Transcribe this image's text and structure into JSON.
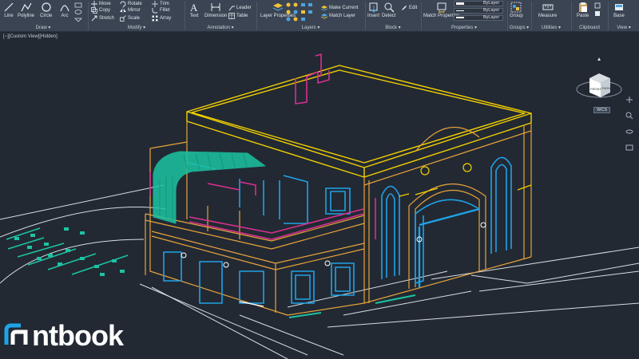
{
  "ribbon": {
    "draw": {
      "title": "Draw ▾",
      "tools": [
        "Line",
        "Polyline",
        "Circle",
        "Arc"
      ]
    },
    "modify": {
      "title": "Modify ▾",
      "tools": [
        "Move",
        "Copy",
        "Stretch",
        "Rotate",
        "Mirror",
        "Scale",
        "Trim",
        "Fillet",
        "Array"
      ]
    },
    "annotation": {
      "title": "Annotation ▾",
      "tools": [
        "Text",
        "Dimension",
        "Leader",
        "Table"
      ]
    },
    "layers": {
      "title": "Layers ▾",
      "tools": [
        "Layer Properties",
        "Make Current",
        "Match Layer"
      ]
    },
    "block": {
      "title": "Block ▾",
      "tools": [
        "Insert",
        "Detect",
        "Edit"
      ]
    },
    "properties": {
      "title": "Properties ▾",
      "tools": [
        "Match Properties"
      ],
      "dropdowns": [
        "ByLayer",
        "ByLayer",
        "ByLayer"
      ]
    },
    "groups": {
      "title": "Groups ▾",
      "tools": [
        "Group"
      ]
    },
    "utilities": {
      "title": "Utilities ▾",
      "tools": [
        "Measure"
      ]
    },
    "clipboard": {
      "title": "Clipboard",
      "tools": [
        "Paste"
      ]
    },
    "view": {
      "title": "View ▾",
      "tools": [
        "Base"
      ]
    }
  },
  "viewport": {
    "label": "[−][Custom View][Hidden]",
    "viewcube": {
      "front": "FRONT",
      "right": "RIGHT",
      "wcs": "WCS"
    }
  },
  "watermark": {
    "text": "ntbook"
  },
  "colors": {
    "ribbon_bg": "#3b4453",
    "viewport_bg": "#222933",
    "outline_yellow": "#f5d100",
    "outline_orange": "#e8a33a",
    "window_blue": "#1fa3e8",
    "accent_magenta": "#d92f8f",
    "awning_teal": "#1cc3a2",
    "ground_white": "#d8dde3"
  }
}
